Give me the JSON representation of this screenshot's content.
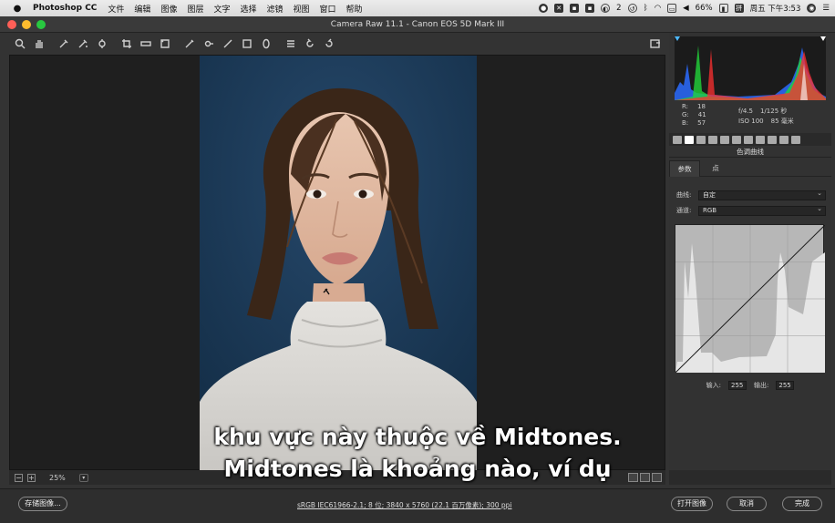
{
  "menubar": {
    "app_name": "Photoshop CC",
    "menus": [
      "文件",
      "编辑",
      "图像",
      "图层",
      "文字",
      "选择",
      "滤镜",
      "视图",
      "窗口",
      "帮助"
    ],
    "wechat_badge": "2",
    "battery": "66%",
    "clock": "周五 下午3:53"
  },
  "window": {
    "title": "Camera Raw 11.1 -  Canon EOS 5D Mark III"
  },
  "zoom": {
    "level": "25%"
  },
  "info": {
    "r_label": "R:",
    "r_value": "18",
    "g_label": "G:",
    "g_value": "41",
    "b_label": "B:",
    "b_value": "57",
    "aperture": "f/4.5",
    "shutter": "1/125 秒",
    "iso": "ISO 100",
    "focal": "85 毫米"
  },
  "panel": {
    "section_title": "色调曲线",
    "tabs": {
      "params": "参数",
      "point": "点"
    },
    "curve_label": "曲线:",
    "curve_value": "自定",
    "channel_label": "通道:",
    "channel_value": "RGB",
    "input_label": "输入:",
    "input_value": "255",
    "output_label": "输出:",
    "output_value": "255"
  },
  "bottom": {
    "save_label": "存储图像...",
    "file_info": "sRGB IEC61966-2.1; 8 位; 3840 x 5760 (22.1 百万像素); 300 ppi",
    "open_label": "打开图像",
    "cancel_label": "取消",
    "done_label": "完成"
  },
  "subtitles": {
    "line1": "khu vực này thuộc về Midtones.",
    "line2": "Midtones là khoảng nào, ví dụ"
  },
  "colors": {
    "photo_background": "#1e3a56",
    "histogram_blue": "#2a6bff",
    "histogram_green": "#22d43a",
    "histogram_red": "#ff3030"
  }
}
